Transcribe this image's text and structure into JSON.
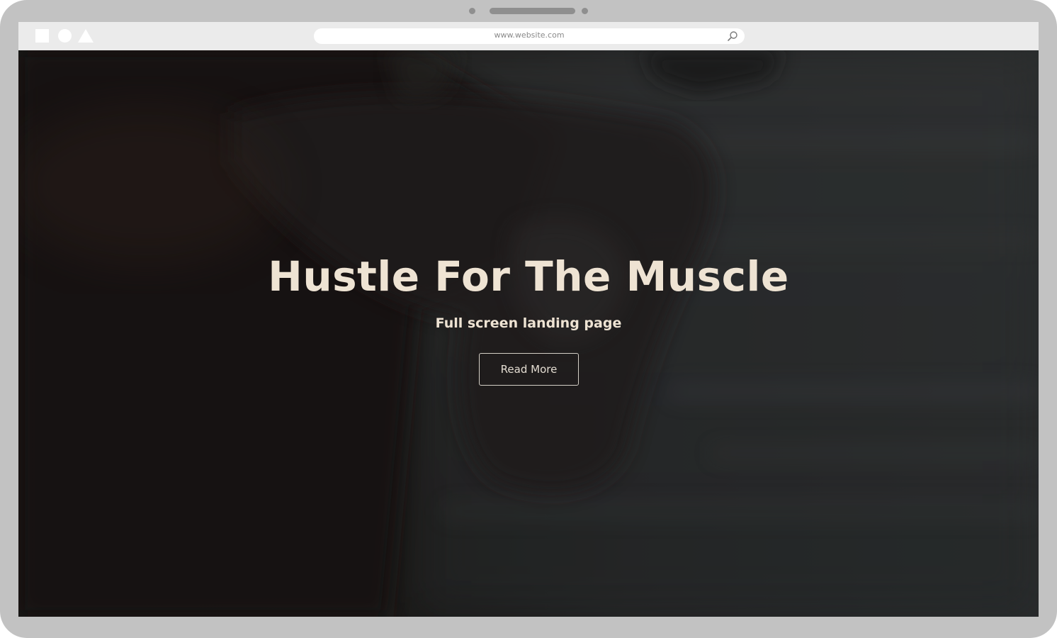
{
  "browser": {
    "url": "www.website.com",
    "window_controls": [
      "square-shape",
      "circle-shape",
      "triangle-shape"
    ],
    "search_icon": "search-icon"
  },
  "hero": {
    "title": "Hustle For The Muscle",
    "subtitle": "Full screen landing page",
    "cta_label": "Read More",
    "background": "photo-boxer-punching-bag"
  },
  "colors": {
    "device_frame": "#c2c2c2",
    "browser_bar": "#ebebeb",
    "title_text": "#eee3d3",
    "button_border": "#d4cfc6",
    "overlay_dark": "#1c1a18"
  }
}
